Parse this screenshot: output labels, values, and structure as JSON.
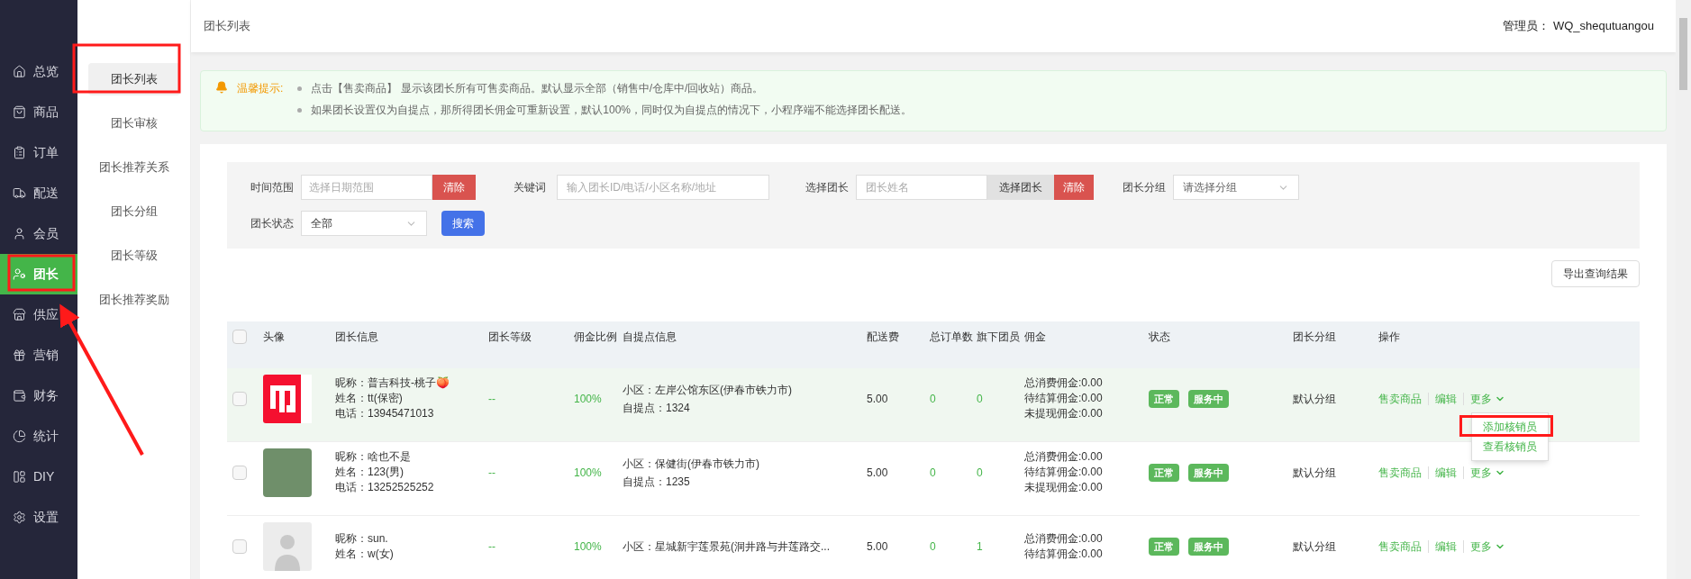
{
  "nav": {
    "items": [
      {
        "label": "总览",
        "selected": false
      },
      {
        "label": "商品",
        "selected": false
      },
      {
        "label": "订单",
        "selected": false
      },
      {
        "label": "配送",
        "selected": false
      },
      {
        "label": "会员",
        "selected": false
      },
      {
        "label": "团长",
        "selected": true
      },
      {
        "label": "供应",
        "selected": false
      },
      {
        "label": "营销",
        "selected": false
      },
      {
        "label": "财务",
        "selected": false
      },
      {
        "label": "统计",
        "selected": false
      },
      {
        "label": "DIY",
        "selected": false
      },
      {
        "label": "设置",
        "selected": false
      }
    ]
  },
  "subnav": {
    "items": [
      {
        "label": "团长列表",
        "selected": true
      },
      {
        "label": "团长审核",
        "selected": false
      },
      {
        "label": "团长推荐关系",
        "selected": false
      },
      {
        "label": "团长分组",
        "selected": false
      },
      {
        "label": "团长等级",
        "selected": false
      },
      {
        "label": "团长推荐奖励",
        "selected": false
      }
    ]
  },
  "header": {
    "breadcrumb": "团长列表",
    "admin": "管理员： WQ_shequtuangou"
  },
  "notice": {
    "title": "温馨提示:",
    "items": [
      "点击【售卖商品】 显示该团长所有可售卖商品。默认显示全部（销售中/仓库中/回收站）商品。",
      "如果团长设置仅为自提点，那所得团长佣金可重新设置，默认100%，同时仅为自提点的情况下，小程序端不能选择团长配送。"
    ]
  },
  "filters": {
    "time_range": {
      "label": "时间范围",
      "placeholder": "选择日期范围",
      "clear": "清除"
    },
    "keyword": {
      "label": "关键词",
      "placeholder": "输入团长ID/电话/小区名称/地址"
    },
    "leader": {
      "label": "选择团长",
      "placeholder": "团长姓名",
      "choose": "选择团长",
      "clear": "清除"
    },
    "group": {
      "label": "团长分组",
      "placeholder": "请选择分组"
    },
    "status": {
      "label": "团长状态",
      "value": "全部"
    },
    "search": "搜索"
  },
  "export_button": "导出查询结果",
  "table": {
    "select_all": {
      "checked": false
    },
    "columns": [
      "头像",
      "团长信息",
      "团长等级",
      "佣金比例",
      "自提点信息",
      "配送费",
      "总订单数",
      "旗下团员",
      "佣金",
      "状态",
      "团长分组",
      "操作"
    ],
    "rows": [
      {
        "checked": false,
        "highlighted": true,
        "avatar": {
          "kind": "logo"
        },
        "info": [
          "昵称：普吉科技-桃子🍑",
          "姓名：tt(保密)",
          "电话：13945471013"
        ],
        "level": "--",
        "ratio": "100%",
        "pickup": [
          "小区：左岸公馆东区(伊春市铁力市)",
          "自提点：1324"
        ],
        "fee": "5.00",
        "orders": "0",
        "members": "0",
        "commission": [
          "总消费佣金:0.00",
          "待结算佣金:0.00",
          "未提现佣金:0.00"
        ],
        "status": [
          "正常",
          "服务中"
        ],
        "group": "默认分组",
        "actions": [
          "售卖商品",
          "编辑",
          "更多"
        ],
        "menu": {
          "expanded": true,
          "items": [
            "添加核销员",
            "查看核销员"
          ]
        }
      },
      {
        "checked": false,
        "highlighted": false,
        "avatar": {
          "kind": "photo"
        },
        "info": [
          "昵称：啥也不是",
          "姓名：123(男)",
          "电话：13252525252"
        ],
        "level": "--",
        "ratio": "100%",
        "pickup": [
          "小区：保健街(伊春市铁力市)",
          "自提点：1235"
        ],
        "fee": "5.00",
        "orders": "0",
        "members": "0",
        "commission": [
          "总消费佣金:0.00",
          "待结算佣金:0.00",
          "未提现佣金:0.00"
        ],
        "status": [
          "正常",
          "服务中"
        ],
        "group": "默认分组",
        "actions": [
          "售卖商品",
          "编辑",
          "更多"
        ]
      },
      {
        "checked": false,
        "highlighted": false,
        "avatar": {
          "kind": "placeholder"
        },
        "info": [
          "昵称：sun.",
          "姓名：w(女)"
        ],
        "level": "--",
        "ratio": "100%",
        "pickup": [
          "小区：星城新宇莲景苑(洞井路与井莲路交..."
        ],
        "fee": "5.00",
        "orders": "0",
        "members": "1",
        "commission": [
          "总消费佣金:0.00",
          "待结算佣金:0.00"
        ],
        "status": [
          "正常",
          "服务中"
        ],
        "group": "默认分组",
        "actions": [
          "售卖商品",
          "编辑",
          "更多"
        ]
      }
    ]
  }
}
